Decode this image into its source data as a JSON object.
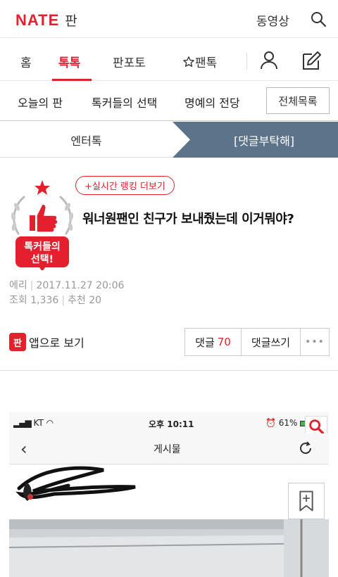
{
  "header": {
    "logo": "NATE",
    "logo_sub": "판",
    "video_link": "동영상"
  },
  "main_nav": {
    "items": [
      "홈",
      "톡톡",
      "판포토",
      "팬톡"
    ]
  },
  "sub_nav": {
    "items": [
      "오늘의 판",
      "톡커들의 선택",
      "명예의 전당"
    ],
    "all_list": "전체목록"
  },
  "tabs": {
    "left": "엔터톡",
    "right": "[댓글부탁해]"
  },
  "article": {
    "badge_text_1": "톡커들의",
    "badge_text_2": "선택!",
    "realtime_ranking": "+실시간 랭킹 더보기",
    "title": "워너원팬인 친구가 보내줬는데 이거뭐야?",
    "author": "에리",
    "datetime": "2017.11.27 20:06",
    "views_label": "조회",
    "views": "1,336",
    "recommend_label": "추천",
    "recommend": "20"
  },
  "actions": {
    "app_icon": "판",
    "app_view": "앱으로 보기",
    "comment_label": "댓글",
    "comment_count": "70",
    "write_comment": "댓글쓰기",
    "more": "•••"
  },
  "embedded": {
    "carrier": "KT",
    "time": "오후 10:11",
    "battery": "61%",
    "nav_title": "게시물"
  },
  "colors": {
    "accent": "#e4202e",
    "tab_active": "#5d7389"
  }
}
